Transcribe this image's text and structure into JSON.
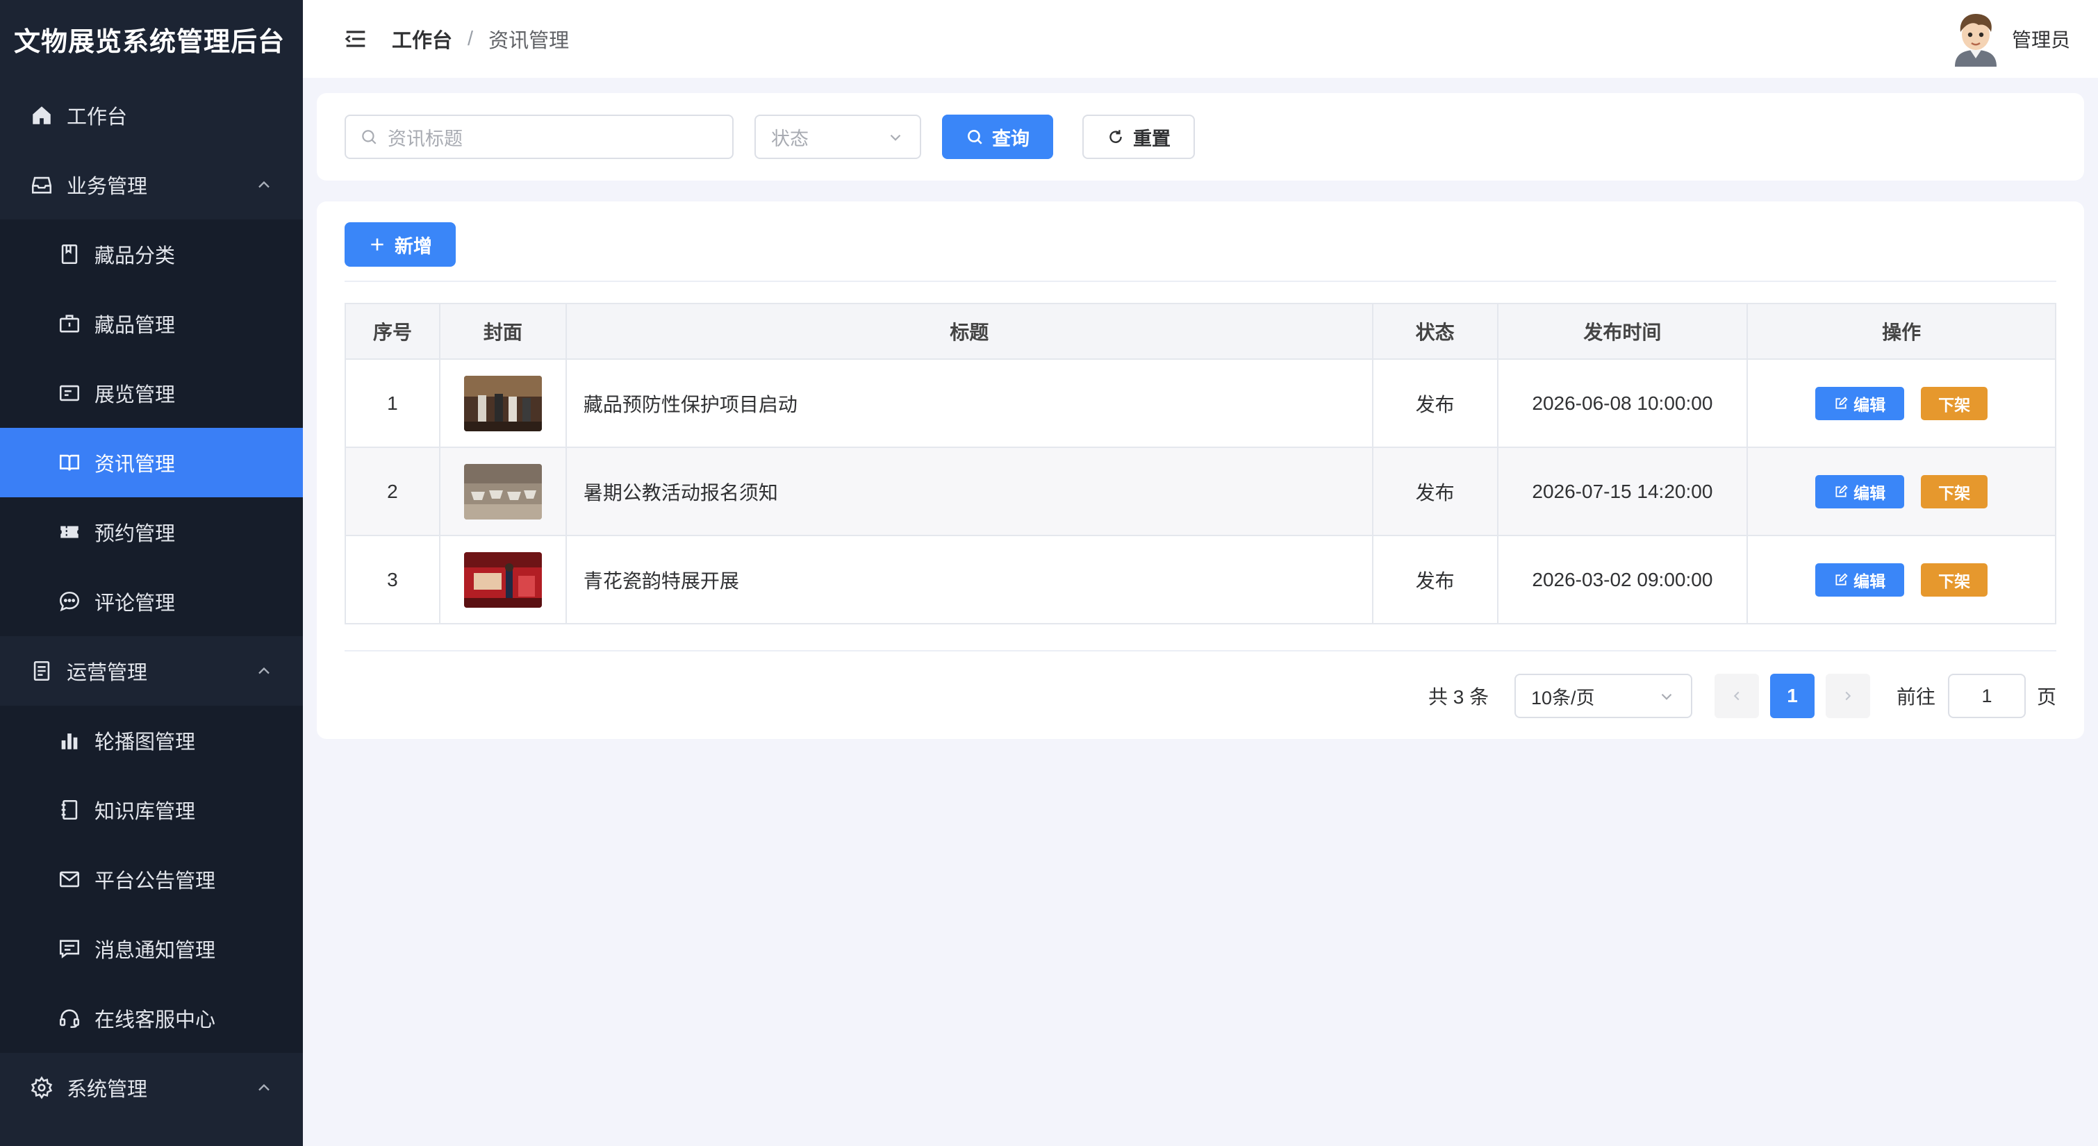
{
  "app": {
    "title": "文物展览系统管理后台"
  },
  "sidebar": {
    "items": [
      {
        "label": "工作台",
        "icon": "home-icon"
      },
      {
        "label": "业务管理",
        "icon": "inbox-icon",
        "expanded": true,
        "children": [
          {
            "label": "藏品分类",
            "icon": "book-icon"
          },
          {
            "label": "藏品管理",
            "icon": "briefcase-icon"
          },
          {
            "label": "展览管理",
            "icon": "card-icon"
          },
          {
            "label": "资讯管理",
            "icon": "open-book-icon",
            "active": true
          },
          {
            "label": "预约管理",
            "icon": "ticket-icon"
          },
          {
            "label": "评论管理",
            "icon": "chat-icon"
          }
        ]
      },
      {
        "label": "运营管理",
        "icon": "document-icon",
        "expanded": true,
        "children": [
          {
            "label": "轮播图管理",
            "icon": "bar-chart-icon"
          },
          {
            "label": "知识库管理",
            "icon": "notebook-icon"
          },
          {
            "label": "平台公告管理",
            "icon": "mail-icon"
          },
          {
            "label": "消息通知管理",
            "icon": "message-icon"
          },
          {
            "label": "在线客服中心",
            "icon": "headset-icon"
          }
        ]
      },
      {
        "label": "系统管理",
        "icon": "gear-icon",
        "expanded": true
      }
    ]
  },
  "header": {
    "breadcrumb": [
      "工作台",
      "资讯管理"
    ],
    "separator": "/",
    "user": "管理员"
  },
  "search": {
    "title_placeholder": "资讯标题",
    "status_placeholder": "状态",
    "query_label": "查询",
    "reset_label": "重置"
  },
  "toolbar": {
    "add_label": "新增"
  },
  "table": {
    "columns": [
      "序号",
      "封面",
      "标题",
      "状态",
      "发布时间",
      "操作"
    ],
    "rows": [
      {
        "index": "1",
        "title": "藏品预防性保护项目启动",
        "status": "发布",
        "time": "2026-06-08 10:00:00"
      },
      {
        "index": "2",
        "title": "暑期公教活动报名须知",
        "status": "发布",
        "time": "2026-07-15 14:20:00"
      },
      {
        "index": "3",
        "title": "青花瓷韵特展开展",
        "status": "发布",
        "time": "2026-03-02 09:00:00"
      }
    ],
    "edit_label": "编辑",
    "offline_label": "下架"
  },
  "pagination": {
    "total_text": "共 3 条",
    "page_size": "10条/页",
    "current_page": "1",
    "goto_label": "前往",
    "goto_value": "1",
    "page_suffix": "页"
  },
  "colors": {
    "sidebar_bg": "#1c2433",
    "primary": "#3a86f8",
    "warning": "#e6982d",
    "active_menu": "#3a7ff6"
  }
}
